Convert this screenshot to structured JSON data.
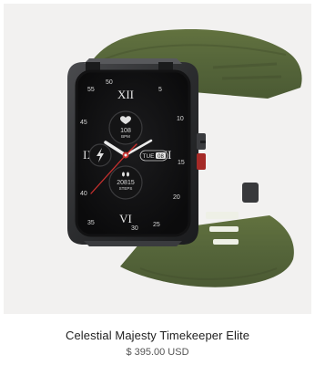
{
  "product": {
    "name": "Celestial Majesty Timekeeper Elite",
    "price": "$ 395.00 USD"
  },
  "watch_face": {
    "numerals": [
      "XII",
      "III",
      "VI",
      "IX"
    ],
    "bezel_numbers": [
      "55",
      "5",
      "10",
      "15",
      "20",
      "25",
      "30",
      "35",
      "40",
      "45",
      "50"
    ],
    "heart_rate_value": "108",
    "heart_rate_unit": "BPM",
    "steps_value": "20815",
    "steps_unit": "STEPS",
    "date_day": "TUE",
    "date_number": "08"
  },
  "colors": {
    "strap": "#5b6a3c",
    "case": "#2a2b2d",
    "accent_red": "#c8312f",
    "panel_bg": "#f2f1f0"
  },
  "icons": [
    "heart-icon",
    "lightning-icon",
    "footsteps-icon"
  ]
}
